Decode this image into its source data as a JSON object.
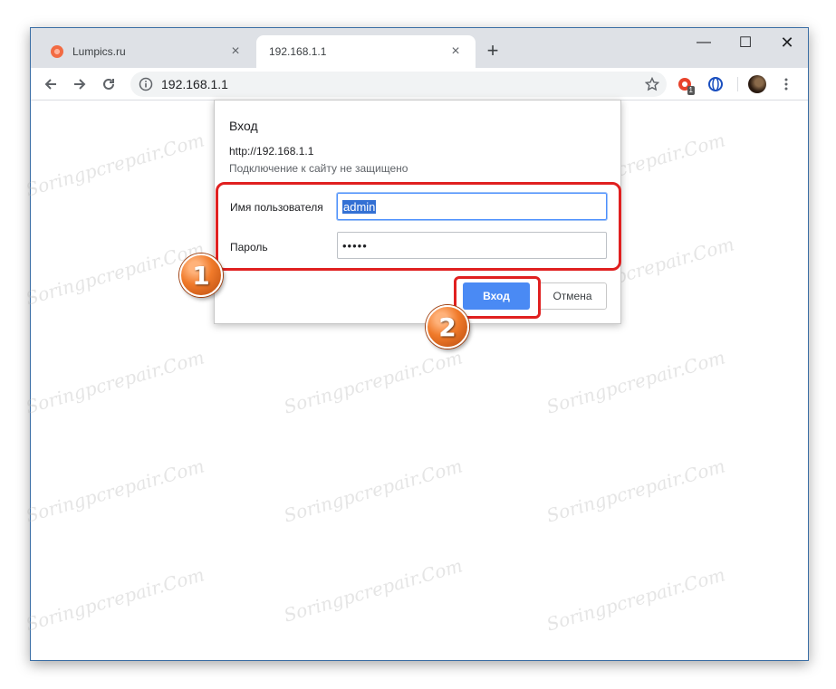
{
  "browser": {
    "tabs": [
      {
        "label": "Lumpics.ru",
        "active": false
      },
      {
        "label": "192.168.1.1",
        "active": true
      }
    ],
    "new_tab_label": "+",
    "window_controls": {
      "minimize": "—",
      "maximize": "☐",
      "close": "✕"
    },
    "address_bar": {
      "url": "192.168.1.1"
    },
    "extension_badge": "1"
  },
  "dialog": {
    "title": "Вход",
    "url": "http://192.168.1.1",
    "warning": "Подключение к сайту не защищено",
    "username_label": "Имя пользователя",
    "username_value": "admin",
    "password_label": "Пароль",
    "password_value": "•••••",
    "login_button": "Вход",
    "cancel_button": "Отмена"
  },
  "annotations": {
    "step1": "1",
    "step2": "2"
  },
  "watermark_text": "Soringpcrepair.Com",
  "colors": {
    "primary_button": "#4a8af4",
    "highlight": "#e02020",
    "step_badge": "#f07a2a"
  },
  "icons": [
    "back-arrow-icon",
    "forward-arrow-icon",
    "reload-icon",
    "info-icon",
    "star-icon",
    "extension-icon",
    "globe-icon",
    "avatar",
    "menu-icon"
  ]
}
